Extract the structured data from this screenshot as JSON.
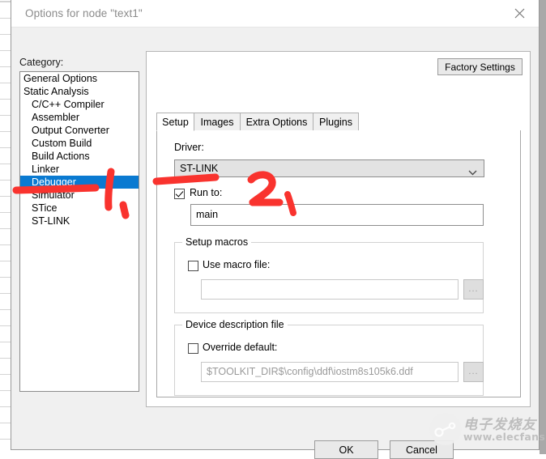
{
  "window": {
    "title": "Options for node \"text1\"",
    "close_icon": "close-icon"
  },
  "category": {
    "label": "Category:",
    "items": [
      {
        "label": "General Options",
        "indent": false,
        "selected": false
      },
      {
        "label": "Static Analysis",
        "indent": false,
        "selected": false
      },
      {
        "label": "C/C++ Compiler",
        "indent": true,
        "selected": false
      },
      {
        "label": "Assembler",
        "indent": true,
        "selected": false
      },
      {
        "label": "Output Converter",
        "indent": true,
        "selected": false
      },
      {
        "label": "Custom Build",
        "indent": true,
        "selected": false
      },
      {
        "label": "Build Actions",
        "indent": true,
        "selected": false
      },
      {
        "label": "Linker",
        "indent": true,
        "selected": false
      },
      {
        "label": "Debugger",
        "indent": true,
        "selected": true
      },
      {
        "label": "Simulator",
        "indent": true,
        "selected": false
      },
      {
        "label": "STice",
        "indent": true,
        "selected": false
      },
      {
        "label": "ST-LINK",
        "indent": true,
        "selected": false
      }
    ]
  },
  "panel": {
    "factory_settings_label": "Factory Settings",
    "tabs": [
      {
        "label": "Setup",
        "active": true
      },
      {
        "label": "Images",
        "active": false
      },
      {
        "label": "Extra Options",
        "active": false
      },
      {
        "label": "Plugins",
        "active": false
      }
    ],
    "driver": {
      "label": "Driver:",
      "selected_value": "ST-LINK",
      "arrow_icon": "chevron-down-icon"
    },
    "run_to": {
      "label": "Run to:",
      "checked": true,
      "value": "main"
    },
    "setup_macros": {
      "group_title": "Setup macros",
      "use_macro_file_label": "Use macro file:",
      "use_macro_file_checked": false,
      "macro_file_value": "",
      "browse_label": "..."
    },
    "device_description": {
      "group_title": "Device description file",
      "override_default_label": "Override default:",
      "override_default_checked": false,
      "path_value": "$TOOLKIT_DIR$\\config\\ddf\\iostm8s105k6.ddf",
      "browse_label": "..."
    }
  },
  "buttons": {
    "ok_label": "OK",
    "cancel_label": "Cancel"
  },
  "watermark": {
    "brand_cn": "电子发烧友",
    "url": "www.elecfans.com"
  },
  "annotations": {
    "color": "#F9332E",
    "marks": [
      {
        "name": "underline-debugger",
        "kind": "stroke"
      },
      {
        "name": "digit-one",
        "kind": "digit",
        "text": "1"
      },
      {
        "name": "underline-driver",
        "kind": "stroke"
      },
      {
        "name": "digit-two",
        "kind": "digit",
        "text": "2"
      }
    ]
  }
}
